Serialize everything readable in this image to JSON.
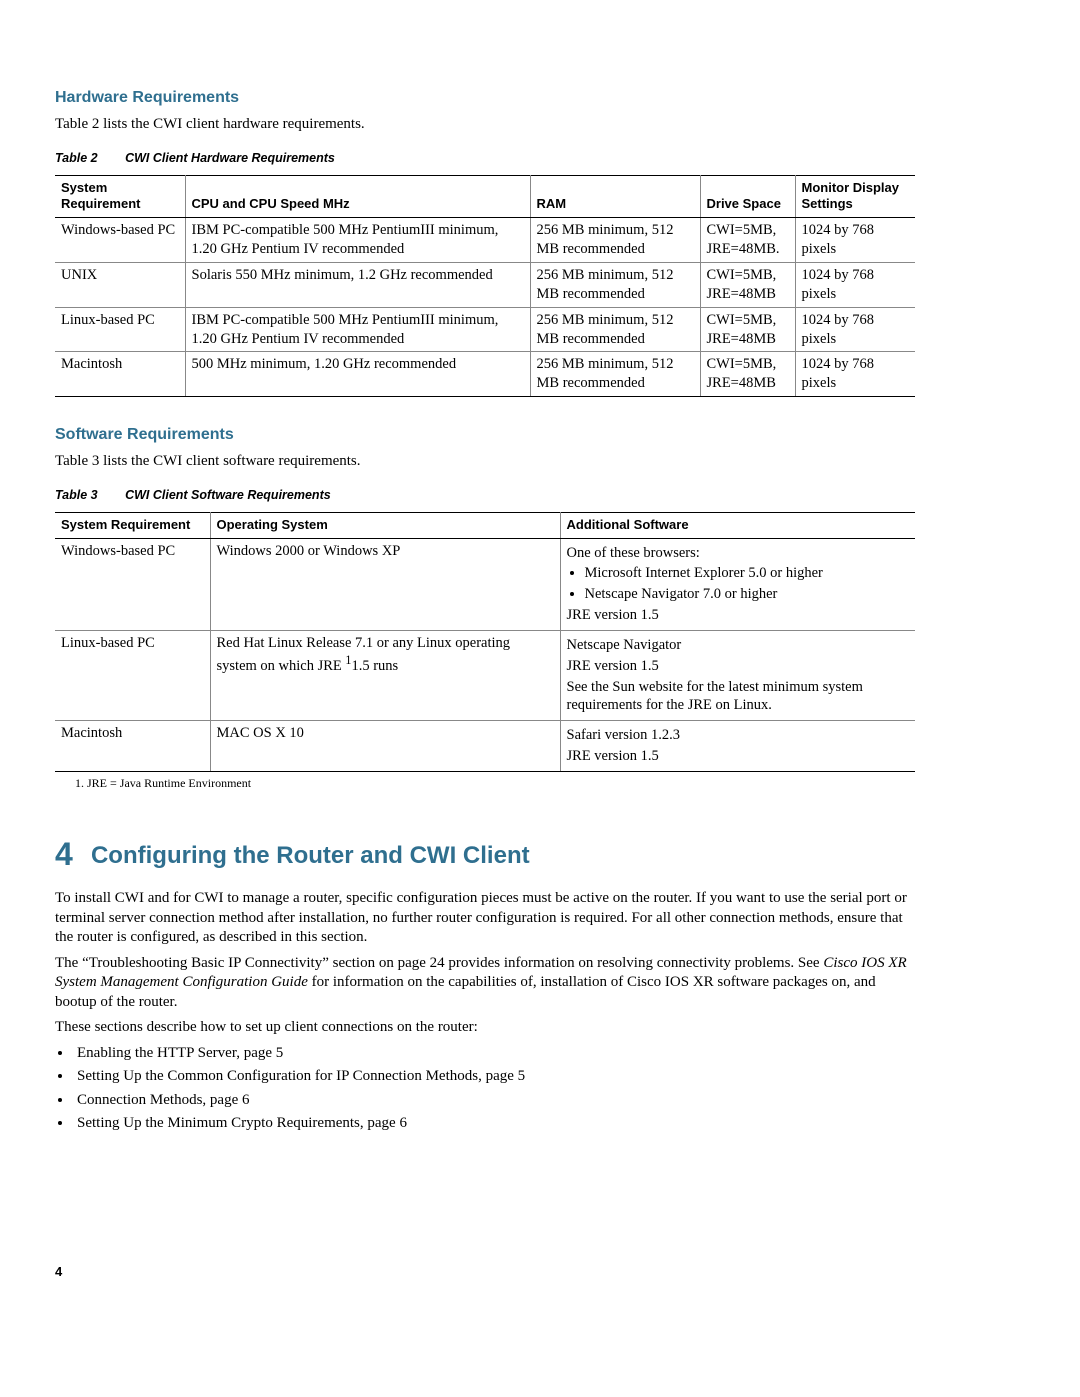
{
  "hardware": {
    "heading": "Hardware Requirements",
    "intro": "Table 2 lists the CWI client hardware requirements.",
    "caption_label": "Table 2",
    "caption_title": "CWI Client Hardware Requirements",
    "headers": {
      "sys": "System Requirement",
      "cpu": "CPU and CPU Speed MHz",
      "ram": "RAM",
      "drive": "Drive Space",
      "monitor": "Monitor Display Settings"
    },
    "rows": [
      {
        "sys": "Windows-based PC",
        "cpu": "IBM PC-compatible 500 MHz PentiumIII minimum, 1.20 GHz Pentium IV recommended",
        "ram": "256 MB minimum, 512 MB recommended",
        "drive": "CWI=5MB, JRE=48MB.",
        "monitor": "1024 by 768 pixels"
      },
      {
        "sys": "UNIX",
        "cpu": "Solaris 550 MHz minimum, 1.2 GHz recommended",
        "ram": "256 MB minimum, 512 MB recommended",
        "drive": "CWI=5MB, JRE=48MB",
        "monitor": "1024 by 768 pixels"
      },
      {
        "sys": "Linux-based PC",
        "cpu": "IBM PC-compatible 500 MHz PentiumIII minimum, 1.20 GHz Pentium IV recommended",
        "ram": "256 MB minimum, 512 MB recommended",
        "drive": "CWI=5MB, JRE=48MB",
        "monitor": "1024 by 768 pixels"
      },
      {
        "sys": "Macintosh",
        "cpu": "500 MHz minimum, 1.20 GHz recommended",
        "ram": "256 MB minimum, 512 MB recommended",
        "drive": "CWI=5MB, JRE=48MB",
        "monitor": "1024 by 768 pixels"
      }
    ]
  },
  "software": {
    "heading": "Software Requirements",
    "intro": "Table 3 lists the CWI client software requirements.",
    "caption_label": "Table 3",
    "caption_title": "CWI Client Software Requirements",
    "headers": {
      "sys": "System Requirement",
      "os": "Operating System",
      "add": "Additional Software"
    },
    "rows": [
      {
        "sys": "Windows-based PC",
        "os": "Windows 2000 or Windows XP",
        "add_intro": "One of these browsers:",
        "add_bullets": [
          "Microsoft Internet Explorer 5.0 or higher",
          "Netscape Navigator 7.0 or higher"
        ],
        "add_tail": [
          "JRE version 1.5"
        ]
      },
      {
        "sys": "Linux-based PC",
        "os_pre": "Red Hat Linux Release 7.1 or any Linux operating system on which JRE ",
        "os_sup": "1",
        "os_post": "1.5 runs",
        "add_lines": [
          "Netscape Navigator",
          "JRE version 1.5",
          "See the Sun website for the latest minimum system requirements for the JRE on Linux."
        ]
      },
      {
        "sys": "Macintosh",
        "os": "MAC OS X 10",
        "add_lines": [
          "Safari version 1.2.3",
          "JRE version 1.5"
        ]
      }
    ],
    "footnote": "1.  JRE = Java Runtime Environment"
  },
  "chapter": {
    "num": "4",
    "title": "Configuring the Router and CWI Client",
    "p1": "To install CWI and for CWI to manage a router, specific configuration pieces must be active on the router. If you want to use the serial port or terminal server connection method after installation, no further router configuration is required. For all other connection methods, ensure that the router is configured, as described in this section.",
    "p2_pre": "The “Troubleshooting Basic IP Connectivity” section on page 24 provides information on resolving connectivity problems. See ",
    "p2_em": "Cisco IOS XR System Management Configuration Guide",
    "p2_post": " for information on the capabilities of, installation of Cisco IOS XR software packages on, and bootup of the router.",
    "p3": "These sections describe how to set up client connections on the router:",
    "bullets": [
      "Enabling the HTTP Server, page 5",
      "Setting Up the Common Configuration for IP Connection Methods, page 5",
      "Connection Methods, page 6",
      "Setting Up the Minimum Crypto Requirements, page 6"
    ]
  },
  "page_number": "4"
}
